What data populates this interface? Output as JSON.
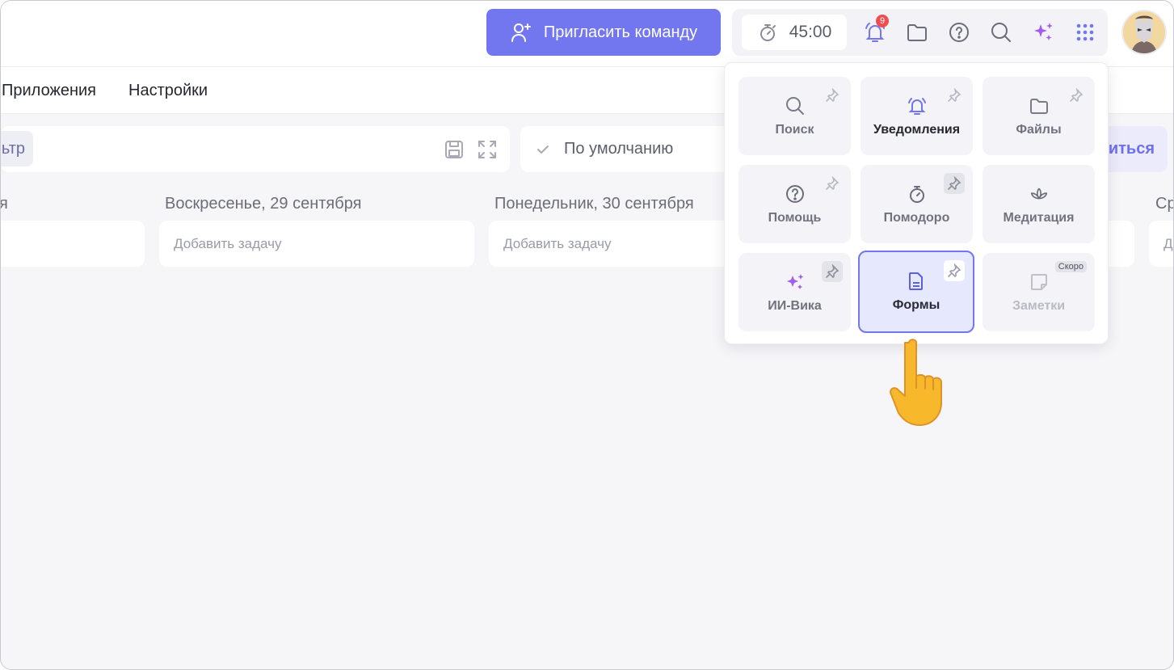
{
  "topbar": {
    "invite_label": "Пригласить команду",
    "timer_value": "45:00",
    "notifications_count": "9"
  },
  "nav": {
    "items": [
      "Приложения",
      "Настройки"
    ]
  },
  "toolbar": {
    "filter_chip": "ьтр",
    "sort_label": "По умолчанию",
    "share_label": "иться"
  },
  "days": [
    {
      "title": "я",
      "add": ""
    },
    {
      "title": "Воскресенье, 29 сентября",
      "add": "Добавить задачу"
    },
    {
      "title": "Понедельник, 30 сентября",
      "add": "Добавить задачу"
    },
    {
      "title": "Ср",
      "add": "Д"
    }
  ],
  "apps_panel": {
    "tiles": [
      {
        "label": "Поиск",
        "icon": "search-icon"
      },
      {
        "label": "Уведомления",
        "icon": "bell-icon"
      },
      {
        "label": "Файлы",
        "icon": "folder-icon"
      },
      {
        "label": "Помощь",
        "icon": "help-icon"
      },
      {
        "label": "Помодоро",
        "icon": "stopwatch-icon"
      },
      {
        "label": "Медитация",
        "icon": "lotus-icon"
      },
      {
        "label": "ИИ-Вика",
        "icon": "sparkles-icon"
      },
      {
        "label": "Формы",
        "icon": "form-icon"
      },
      {
        "label": "Заметки",
        "icon": "note-icon"
      }
    ],
    "soon_badge": "Скоро"
  },
  "colors": {
    "accent": "#7276ef",
    "badge": "#ef4e4e"
  }
}
